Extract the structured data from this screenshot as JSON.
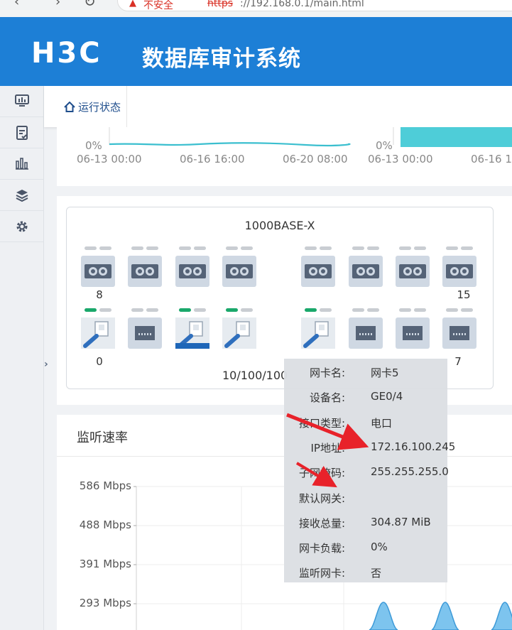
{
  "browser": {
    "security_warning": "不安全",
    "url_protocol": "https",
    "url_rest": "://192.168.0.1/main.html"
  },
  "header": {
    "logo": "H3C",
    "title": "数据库审计系统",
    "brand_color": "#1d7fd6"
  },
  "sidebar": {
    "items": [
      {
        "icon": "monitor-icon"
      },
      {
        "icon": "audit-report-icon"
      },
      {
        "icon": "bar-chart-icon"
      },
      {
        "icon": "layers-icon"
      },
      {
        "icon": "gear-icon"
      }
    ]
  },
  "tabs": [
    {
      "label": "运行状态",
      "icon": "home-icon"
    }
  ],
  "top_chart": {
    "left_zero": "0%",
    "left_ticks": [
      "06-13 00:00",
      "06-16 16:00",
      "06-20 08:00"
    ],
    "right_zero": "0%",
    "right_ticks": [
      "06-13 00:00",
      "06-16 1"
    ]
  },
  "ports": {
    "sfp_title": "1000BASE-X",
    "sfp_numbers": {
      "first": "8",
      "last": "15"
    },
    "rj45_title": "10/100/100",
    "rj45_numbers": {
      "first": "0",
      "last": "7"
    },
    "led_on_color": "#1aa86b"
  },
  "rate_chart": {
    "title": "监听速率",
    "y_ticks": [
      "586 Mbps",
      "488 Mbps",
      "391 Mbps",
      "293 Mbps"
    ],
    "series_color": "#7dc4ee"
  },
  "tooltip": {
    "rows": [
      {
        "key": "网卡名:",
        "value": "网卡5"
      },
      {
        "key": "设备名:",
        "value": "GE0/4"
      },
      {
        "key": "接口类型:",
        "value": "电口"
      },
      {
        "key": "IP地址:",
        "value": "172.16.100.245"
      },
      {
        "key": "子网掩码:",
        "value": "255.255.255.0"
      },
      {
        "key": "默认网关:",
        "value": ""
      },
      {
        "key": "接收总量:",
        "value": "304.87 MiB"
      },
      {
        "key": "网卡负载:",
        "value": "0%"
      },
      {
        "key": "监听网卡:",
        "value": "否"
      }
    ]
  },
  "annotation_color": "#e8222a"
}
